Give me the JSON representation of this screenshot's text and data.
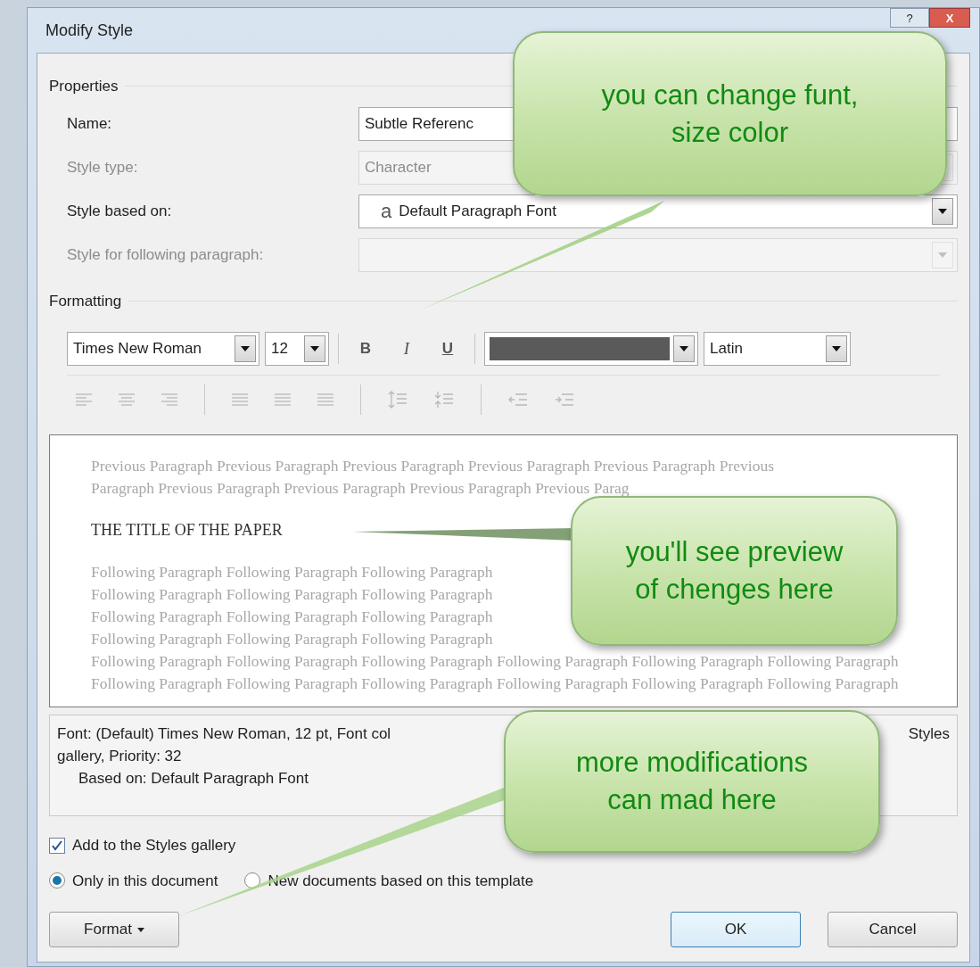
{
  "window": {
    "title": "Modify Style",
    "help": "?",
    "close": "X"
  },
  "properties": {
    "heading": "Properties",
    "rows": [
      {
        "label": "Name:",
        "value": "Subtle Referenc",
        "disabled": false,
        "kind": "text"
      },
      {
        "label": "Style type:",
        "value": "Character",
        "disabled": true,
        "kind": "dropdown"
      },
      {
        "label": "Style based on:",
        "glyph": "a",
        "value": "Default Paragraph Font",
        "disabled": false,
        "kind": "dropdown"
      },
      {
        "label": "Style for following paragraph:",
        "disabled": true,
        "kind": "dropdown"
      }
    ]
  },
  "formatting": {
    "heading": "Formatting",
    "font": "Times New Roman",
    "size": "12",
    "bold": "B",
    "italic": "I",
    "underline": "U",
    "color": "#5a5a5a",
    "script": "Latin"
  },
  "preview": {
    "previous_lines": [
      "Previous Paragraph Previous Paragraph Previous Paragraph Previous Paragraph Previous Paragraph Previous",
      "Paragraph Previous Paragraph Previous Paragraph Previous Paragraph Previous Parag"
    ],
    "sample": "THE TITLE OF THE PAPER",
    "following_lines": [
      "Following Paragraph Following Paragraph Following Paragraph",
      "Following Paragraph Following Paragraph Following Paragraph",
      "Following Paragraph Following Paragraph Following Paragraph",
      "Following Paragraph Following Paragraph Following Paragraph",
      "Following Paragraph Following Paragraph Following Paragraph Following Paragraph Following Paragraph Following Paragraph",
      "Following Paragraph Following Paragraph Following Paragraph Following Paragraph Following Paragraph Following Paragraph"
    ]
  },
  "description": {
    "lines": [
      {
        "kind": "split",
        "parts": [
          "Font: (Default) Times New Roman, 12 pt, Font col",
          "Styles"
        ]
      },
      {
        "kind": "plain",
        "parts": [
          "gallery, Priority: 32"
        ]
      },
      {
        "kind": "indented",
        "parts": [
          "Based on: Default Paragraph Font"
        ]
      }
    ]
  },
  "gallery_checkbox": {
    "label": "Add to the Styles gallery",
    "checked": true
  },
  "scope": [
    {
      "label": "Only in this document",
      "selected": true
    },
    {
      "label": "New documents based on this template",
      "selected": false
    }
  ],
  "buttons": {
    "format": {
      "label": "Format"
    },
    "ok": {
      "label": "OK",
      "default": true
    },
    "cancel": {
      "label": "Cancel",
      "default": false
    }
  },
  "callouts": [
    {
      "lines": [
        "you can change funt,",
        "size color"
      ]
    },
    {
      "lines": [
        "you'll see preview",
        "of chenges here"
      ]
    },
    {
      "lines": [
        "more modifications",
        "can mad here"
      ]
    }
  ]
}
